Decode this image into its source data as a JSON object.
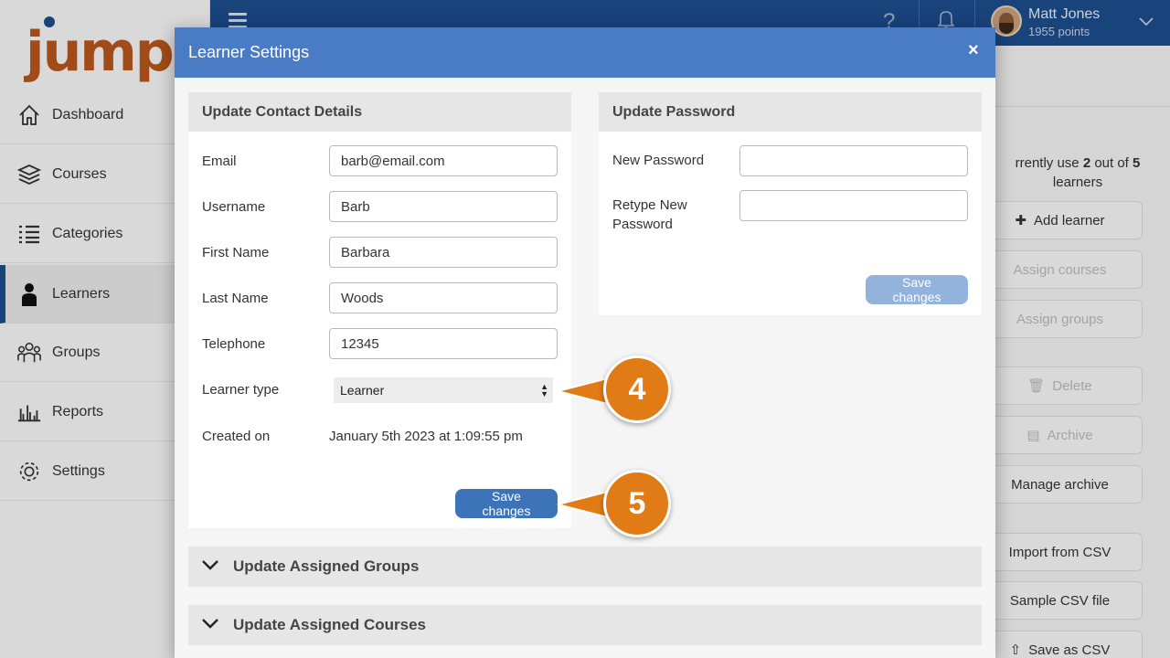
{
  "app": {
    "logo_text": "jump",
    "user": {
      "name": "Matt Jones",
      "points": "1955 points"
    }
  },
  "sidebar": {
    "items": [
      {
        "label": "Dashboard",
        "icon": "home-icon"
      },
      {
        "label": "Courses",
        "icon": "layers-icon"
      },
      {
        "label": "Categories",
        "icon": "list-icon"
      },
      {
        "label": "Learners",
        "icon": "person-icon",
        "active": true
      },
      {
        "label": "Groups",
        "icon": "group-icon"
      },
      {
        "label": "Reports",
        "icon": "bar-chart-icon"
      },
      {
        "label": "Settings",
        "icon": "gear-icon"
      }
    ]
  },
  "right_panel": {
    "usage_prefix": "rrently use ",
    "usage_used": "2",
    "usage_mid": " out of ",
    "usage_total": "5",
    "usage_suffix": "learners",
    "buttons": [
      {
        "label": "Add learner",
        "icon": "plus-icon",
        "disabled": false
      },
      {
        "label": "Assign courses",
        "disabled": true
      },
      {
        "label": "Assign groups",
        "disabled": true
      },
      {
        "label": "Delete",
        "icon": "trash-icon",
        "disabled": true
      },
      {
        "label": "Archive",
        "icon": "archive-icon",
        "disabled": true
      },
      {
        "label": "Manage archive",
        "disabled": false
      },
      {
        "label": "Import from CSV",
        "disabled": false
      },
      {
        "label": "Sample CSV file",
        "disabled": false
      },
      {
        "label": "Save as CSV",
        "icon": "upload-icon",
        "disabled": false
      }
    ]
  },
  "modal": {
    "title": "Learner Settings",
    "close_symbol": "×",
    "contact": {
      "heading": "Update Contact Details",
      "fields": {
        "email": {
          "label": "Email",
          "value": "barb@email.com"
        },
        "username": {
          "label": "Username",
          "value": "Barb"
        },
        "first_name": {
          "label": "First Name",
          "value": "Barbara"
        },
        "last_name": {
          "label": "Last Name",
          "value": "Woods"
        },
        "telephone": {
          "label": "Telephone",
          "value": "12345"
        }
      },
      "learner_type": {
        "label": "Learner type",
        "value": "Learner"
      },
      "created_on": {
        "label": "Created on",
        "value": "January 5th 2023 at 1:09:55 pm"
      },
      "save_label": "Save changes"
    },
    "password": {
      "heading": "Update Password",
      "new_label": "New Password",
      "retype_label_1": "Retype New",
      "retype_label_2": "Password",
      "new_value": "",
      "retype_value": "",
      "save_label": "Save changes"
    },
    "accordions": {
      "groups": "Update Assigned Groups",
      "courses": "Update Assigned Courses"
    }
  },
  "callouts": {
    "first": "4",
    "second": "5"
  },
  "colors": {
    "brand_blue": "#1d4d8c",
    "modal_header": "#4a7cc5",
    "callout_orange": "#e07b16",
    "logo_orange": "#b8561c"
  }
}
